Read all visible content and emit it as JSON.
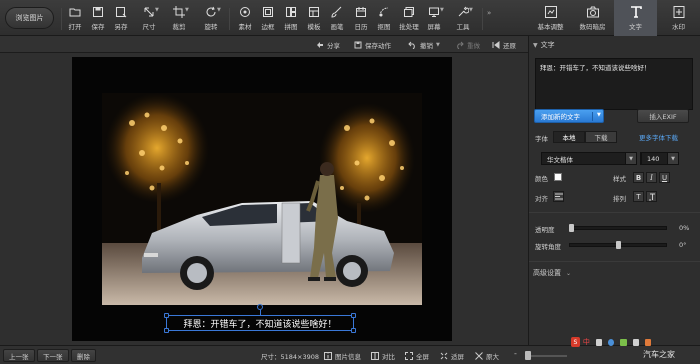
{
  "toolbar": {
    "browse_label": "浏览图片",
    "tools": [
      {
        "label": "打开",
        "icon": "folder-icon"
      },
      {
        "label": "保存",
        "icon": "save-icon"
      },
      {
        "label": "另存",
        "icon": "save-as-icon"
      },
      {
        "label": "尺寸",
        "icon": "resize-icon"
      },
      {
        "label": "裁剪",
        "icon": "crop-icon"
      },
      {
        "label": "旋转",
        "icon": "rotate-icon"
      },
      {
        "label": "素材",
        "icon": "material-icon"
      },
      {
        "label": "边框",
        "icon": "border-icon"
      },
      {
        "label": "拼图",
        "icon": "puzzle-icon"
      },
      {
        "label": "模板",
        "icon": "template-icon"
      },
      {
        "label": "画笔",
        "icon": "brush-icon"
      },
      {
        "label": "日历",
        "icon": "calendar-icon"
      },
      {
        "label": "抠图",
        "icon": "cutout-icon"
      },
      {
        "label": "批处理",
        "icon": "batch-icon"
      },
      {
        "label": "屏幕",
        "icon": "screen-icon"
      },
      {
        "label": "工具",
        "icon": "tools-icon"
      }
    ],
    "right_tabs": [
      {
        "label": "基本调整",
        "icon": "adjust-icon"
      },
      {
        "label": "数码暗房",
        "icon": "camera-icon"
      },
      {
        "label": "文字",
        "icon": "text-icon",
        "active": true
      },
      {
        "label": "水印",
        "icon": "watermark-icon"
      }
    ]
  },
  "subbar": {
    "share": "分享",
    "save_action": "保存动作",
    "undo": "撤销",
    "redo": "重做",
    "restore": "还原"
  },
  "canvas": {
    "caption_text": "拜恩：开错车了，不知道该说些啥好！"
  },
  "bottom": {
    "prev": "上一张",
    "next": "下一张",
    "delete": "删除",
    "size_label": "尺寸：5184×3908",
    "info": "图片信息",
    "compare": "对比",
    "fullscreen": "全屏",
    "fit": "适屏",
    "original": "原大"
  },
  "panel": {
    "section_title": "文字",
    "text_value": "拜恩：开错车了，不知道该说些啥好！",
    "add_text_button": "添加新的文字",
    "insert_exif_button": "插入EXIF",
    "font_label": "字体",
    "local_tab": "本地",
    "download_tab": "下载",
    "more_fonts": "更多字体下载",
    "font_name": "华文楷体",
    "font_size": "140",
    "color_label": "颜色",
    "style_label": "样式",
    "style_bold": "B",
    "style_italic": "I",
    "style_underline": "U",
    "align_label": "对齐",
    "arrange_label": "排列",
    "opacity_label": "透明度",
    "opacity_value": "0%",
    "opacity_level": 0,
    "rotation_label": "旋转角度",
    "rotation_value": "0°",
    "rotation_level": 0.5,
    "advanced_label": "高级设置"
  },
  "watermark_text": "汽车之家"
}
